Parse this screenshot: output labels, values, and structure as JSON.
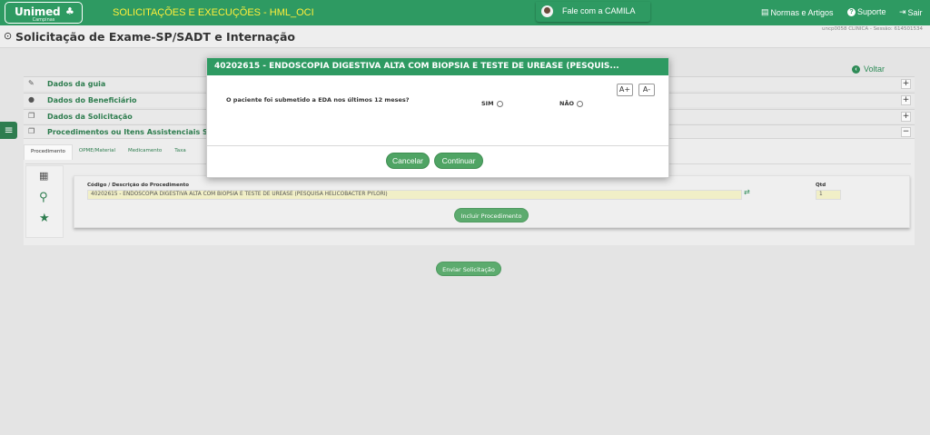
{
  "header": {
    "logo": "Unimed",
    "logo_sub": "Campinas",
    "app_title": "SOLICITAÇÕES E EXECUÇÕES - HML_OCI",
    "chat_label": "Fale com a CAMILA",
    "links": {
      "normas": "Normas e Artigos",
      "suporte": "Suporte",
      "sair": "Sair"
    },
    "colors": {
      "bar": "#2e9a62",
      "title": "#ffef3a"
    }
  },
  "subheader": {
    "title": "Solicitação de Exame-SP/SADT e Internação",
    "session": "uncp0058 CLINICA - Sessão: 614501534"
  },
  "voltar": "Voltar",
  "sections": [
    {
      "label": "Dados da guia",
      "icon": "edit-icon",
      "toggle": "+"
    },
    {
      "label": "Dados do Beneficiário",
      "icon": "user-icon",
      "toggle": "+"
    },
    {
      "label": "Dados da Solicitação",
      "icon": "copy-icon",
      "toggle": "+"
    },
    {
      "label": "Procedimentos ou Itens Assistenciais Solic",
      "icon": "copy-icon",
      "toggle": "−"
    }
  ],
  "procedure_panel": {
    "tabs": [
      "Procedimento",
      "OPME/Material",
      "Medicamento",
      "Taxa"
    ],
    "code_label": "Código / Descrição do Procedimento",
    "code_value": "40202615 - ENDOSCOPIA DIGESTIVA ALTA COM BIOPSIA E TESTE DE UREASE (PESQUISA HELICOBACTER PYLORI)",
    "qty_label": "Qtd",
    "qty_value": "1",
    "include_button": "Incluir Procedimento"
  },
  "send_button": "Enviar Solicitação",
  "modal": {
    "title": "40202615 - ENDOSCOPIA DIGESTIVA ALTA COM BIOPSIA E TESTE DE UREASE (PESQUIS...",
    "font_increase": "A+",
    "font_decrease": "A-",
    "question": "O paciente foi submetido a EDA nos últimos 12 meses?",
    "option_yes": "SIM",
    "option_no": "NÃO",
    "cancel": "Cancelar",
    "continue": "Continuar"
  }
}
